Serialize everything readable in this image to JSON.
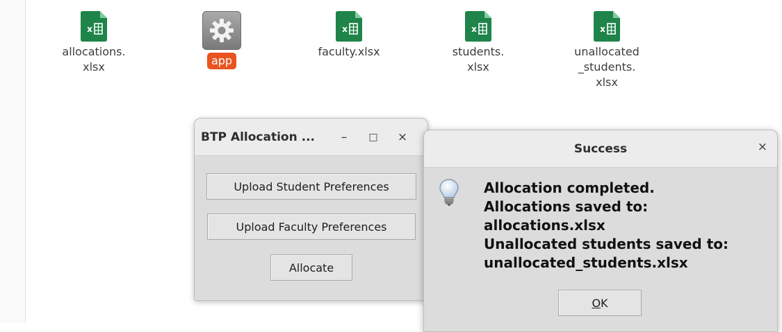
{
  "desktop": {
    "files": [
      {
        "label": "allocations.\nxlsx",
        "icon": "excel-file-icon"
      },
      {
        "label": "app",
        "icon": "gear-executable-icon"
      },
      {
        "label": "faculty.xlsx",
        "icon": "excel-file-icon"
      },
      {
        "label": "students.\nxlsx",
        "icon": "excel-file-icon"
      },
      {
        "label": "unallocated\n_students.\nxlsx",
        "icon": "excel-file-icon"
      }
    ]
  },
  "main_window": {
    "title": "BTP Allocation ...",
    "controls": {
      "minimize": "–",
      "maximize": "□",
      "close": "×"
    },
    "buttons": {
      "upload_students": "Upload Student Preferences",
      "upload_faculty": "Upload Faculty Preferences",
      "allocate": "Allocate"
    }
  },
  "dialog": {
    "title": "Success",
    "close": "×",
    "icon": "lightbulb-info-icon",
    "message": [
      "Allocation completed.",
      "Allocations saved to:",
      "allocations.xlsx",
      "Unallocated students saved to:",
      "unallocated_students.xlsx"
    ],
    "ok_mnemonic": "O",
    "ok_rest": "K"
  },
  "colors": {
    "excel_green": "#1e8449",
    "selection_orange": "#e95420"
  }
}
